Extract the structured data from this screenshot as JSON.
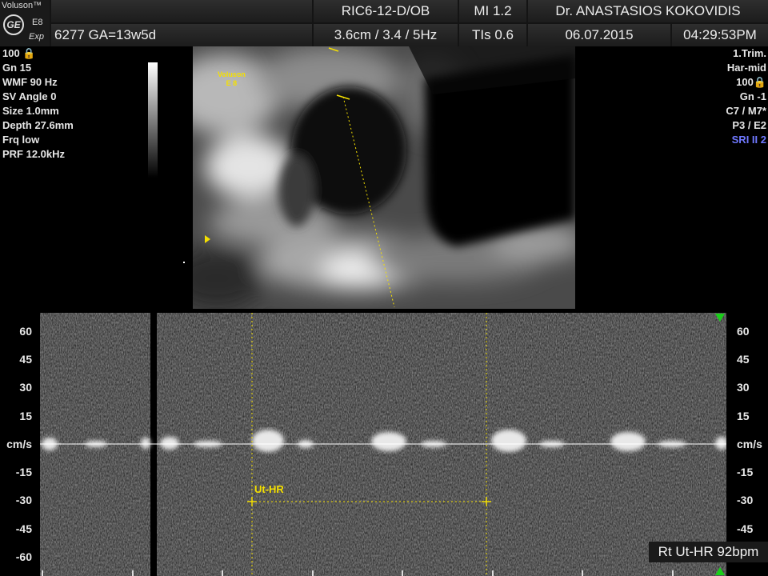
{
  "header": {
    "brand_name": "Voluson™",
    "logo_text": "GE",
    "model_line1": "E8",
    "model_line2": "Exp",
    "patient": "6277  GA=13w5d",
    "probe": "RIC6-12-D/OB",
    "mi": "MI  1.2",
    "doctor": "Dr. ANASTASIOS KOKOVIDIS",
    "depth_info": "3.6cm / 3.4 /  5Hz",
    "tis": "TIs  0.6",
    "date": "06.07.2015",
    "time": "04:29:53PM"
  },
  "left_params": [
    "100 🔒",
    "Gn  15",
    "WMF 90 Hz",
    "SV Angle  0",
    "Size  1.0mm",
    "Depth 27.6mm",
    "Frq low",
    "PRF 12.0kHz"
  ],
  "right_params": [
    "1.Trim.",
    "Har-mid",
    "100🔒",
    "Gn  -1",
    "C7 / M7*",
    "P3 / E2",
    "SRI II 2"
  ],
  "image_logo": {
    "line1": "Voluson",
    "line2": "E 8"
  },
  "doppler": {
    "scale_labels": [
      "60",
      "45",
      "30",
      "15",
      "cm/s",
      "-15",
      "-30",
      "-45",
      "-60"
    ],
    "measure_label": "Ut-HR",
    "heart_rate_readout": "Rt Ut-HR 92bpm"
  },
  "colors": {
    "caliper": "#f5e000",
    "marker_green": "#18d018",
    "sri_blue": "#6f78ff"
  }
}
